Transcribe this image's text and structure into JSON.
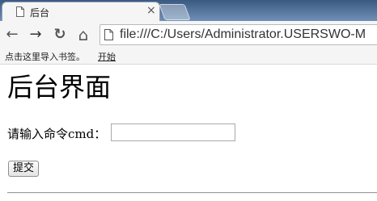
{
  "browser": {
    "tab": {
      "title": "后台",
      "close_glyph": "×",
      "icon": "document-icon"
    },
    "nav": {
      "back_glyph": "←",
      "forward_glyph": "→",
      "reload_glyph": "↻",
      "home_glyph": "⌂"
    },
    "address_bar": {
      "url": "file:///C:/Users/Administrator.USERSWO-M",
      "icon": "page-icon"
    },
    "bookmarks_bar": {
      "hint": "点击这里导入书签。",
      "link": "开始"
    }
  },
  "page": {
    "heading": "后台界面",
    "form": {
      "command_label": "请输入命令cmd：",
      "command_value": "",
      "submit_label": "提交"
    }
  }
}
